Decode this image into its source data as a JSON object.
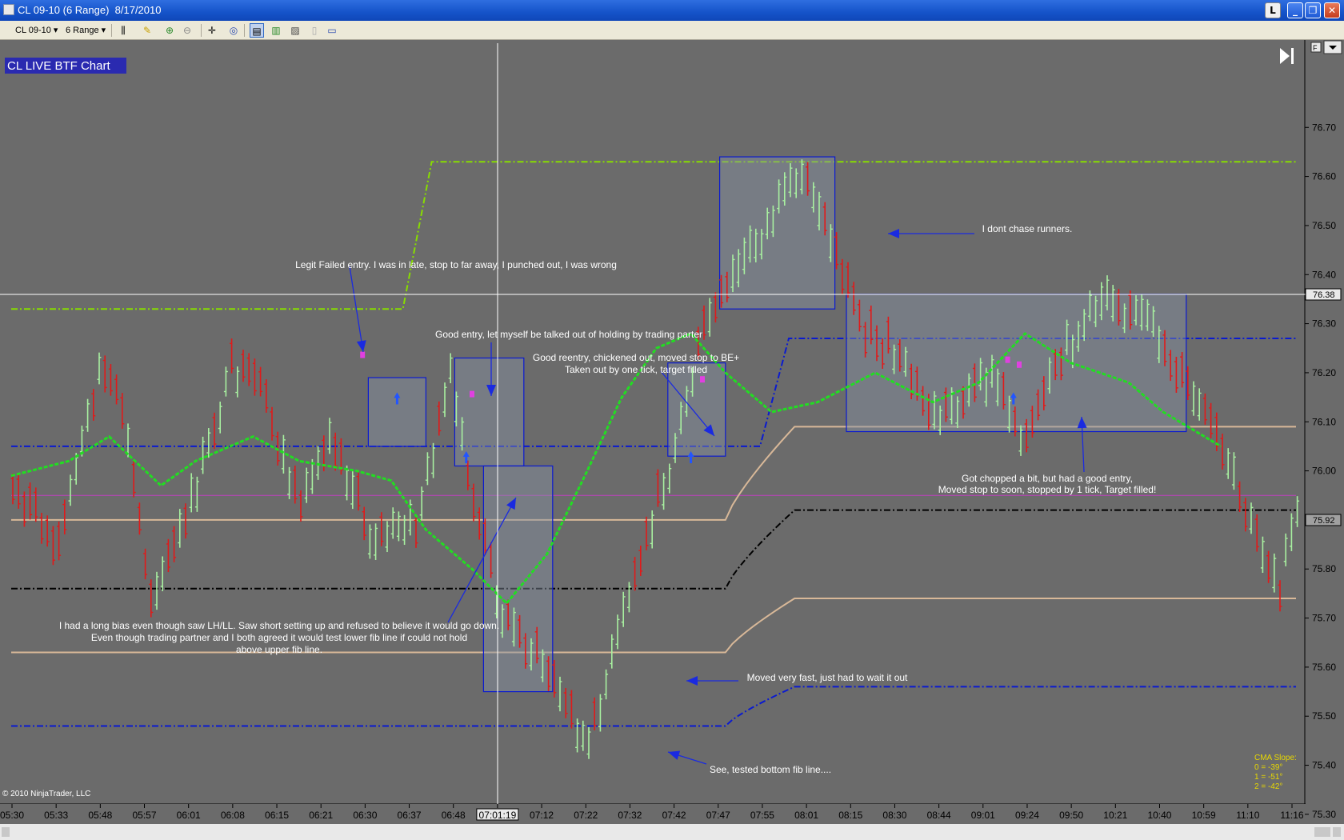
{
  "window": {
    "title": "CL 09-10 (6 Range)  8/17/2010",
    "buttons": [
      "L",
      "_",
      "❐",
      "✕"
    ]
  },
  "toolbar": {
    "instrument": "CL 09-10",
    "period": "6 Range"
  },
  "chart": {
    "label": "CL LIVE BTF Chart",
    "copyright": "© 2010 NinjaTrader, LLC",
    "crosshair_time": "07:01:19",
    "crosshair_price": "76.38",
    "last_price": "75.92",
    "cma_slope": {
      "title": "CMA Slope:",
      "lines": [
        "0 = -39°",
        "1 = -51°",
        "2 = -42°"
      ]
    },
    "colors": {
      "background": "#6b6b6b",
      "up_bar": "#a8f0a0",
      "down_bar": "#e01a1a",
      "cma": "#22dd22",
      "fib_green": "#88dd00",
      "fib_blue": "#0a1ad0",
      "fib_tan": "#d8b898",
      "fib_black": "#000000",
      "magenta": "#c040c0",
      "label_bg": "#2a2ab0"
    }
  },
  "chart_data": {
    "type": "bar",
    "subtype": "ohlc-range-bars",
    "instrument": "CL 09-10",
    "period": "6 Range",
    "date": "8/17/2010",
    "y_axis": {
      "ticks": [
        75.3,
        75.4,
        75.5,
        75.6,
        75.7,
        75.8,
        75.9,
        76.0,
        76.1,
        76.2,
        76.3,
        76.4,
        76.5,
        76.6,
        76.7
      ],
      "labels": [
        "75.30",
        "75.40",
        "75.50",
        "75.60",
        "75.70",
        "75.80",
        "75.90",
        "76.00",
        "76.10",
        "76.20",
        "76.30",
        "76.40",
        "76.50",
        "76.60",
        "76.70"
      ],
      "ylim": [
        75.27,
        76.78
      ]
    },
    "x_axis": {
      "labels": [
        "05:30",
        "05:33",
        "05:48",
        "05:57",
        "06:01",
        "06:08",
        "06:15",
        "06:21",
        "06:30",
        "06:37",
        "06:48",
        "07:01:19",
        "07:12",
        "07:22",
        "07:32",
        "07:42",
        "07:47",
        "07:55",
        "08:01",
        "08:15",
        "08:30",
        "08:44",
        "09:01",
        "09:24",
        "09:50",
        "10:21",
        "10:40",
        "10:59",
        "11:10",
        "11:16"
      ]
    },
    "price_path": [
      [
        0,
        75.98
      ],
      [
        8,
        75.86
      ],
      [
        15,
        76.22
      ],
      [
        19,
        76.14
      ],
      [
        24,
        75.76
      ],
      [
        30,
        75.9
      ],
      [
        38,
        76.22
      ],
      [
        43,
        76.18
      ],
      [
        50,
        75.92
      ],
      [
        55,
        76.1
      ],
      [
        62,
        75.88
      ],
      [
        70,
        75.9
      ],
      [
        76,
        76.2
      ],
      [
        79,
        76.0
      ],
      [
        85,
        75.72
      ],
      [
        92,
        75.62
      ],
      [
        100,
        75.45
      ],
      [
        108,
        75.8
      ],
      [
        114,
        76.02
      ],
      [
        120,
        76.3
      ],
      [
        126,
        76.42
      ],
      [
        133,
        76.55
      ],
      [
        138,
        76.62
      ],
      [
        142,
        76.48
      ],
      [
        148,
        76.3
      ],
      [
        153,
        76.25
      ],
      [
        160,
        76.12
      ],
      [
        170,
        76.2
      ],
      [
        176,
        76.08
      ],
      [
        183,
        76.26
      ],
      [
        190,
        76.38
      ],
      [
        198,
        76.3
      ],
      [
        208,
        76.1
      ],
      [
        215,
        75.9
      ],
      [
        220,
        75.78
      ],
      [
        223,
        75.92
      ]
    ],
    "moving_average": [
      [
        0,
        75.99
      ],
      [
        10,
        76.02
      ],
      [
        17,
        76.07
      ],
      [
        26,
        75.97
      ],
      [
        32,
        76.02
      ],
      [
        42,
        76.07
      ],
      [
        50,
        76.02
      ],
      [
        60,
        76.0
      ],
      [
        66,
        75.98
      ],
      [
        72,
        75.88
      ],
      [
        80,
        75.8
      ],
      [
        86,
        75.73
      ],
      [
        93,
        75.83
      ],
      [
        100,
        76.0
      ],
      [
        106,
        76.15
      ],
      [
        112,
        76.25
      ],
      [
        118,
        76.28
      ],
      [
        124,
        76.2
      ],
      [
        132,
        76.12
      ],
      [
        140,
        76.14
      ],
      [
        150,
        76.2
      ],
      [
        160,
        76.14
      ],
      [
        168,
        76.18
      ],
      [
        176,
        76.28
      ],
      [
        184,
        76.22
      ],
      [
        194,
        76.18
      ],
      [
        200,
        76.12
      ],
      [
        210,
        76.05
      ]
    ],
    "levels": [
      {
        "name": "upper fib green",
        "price": 76.33,
        "until": 68,
        "then": 76.63
      },
      {
        "name": "blue dashed",
        "price": 76.05,
        "until": 130,
        "then": 76.27
      },
      {
        "name": "magenta",
        "price": 75.95
      },
      {
        "name": "tan upper",
        "price": 75.9,
        "then": 76.09
      },
      {
        "name": "black dashed",
        "price": 75.76,
        "then": 75.92
      },
      {
        "name": "tan lower",
        "price": 75.63,
        "then": 75.74
      },
      {
        "name": "blue lower",
        "price": 75.48,
        "then": 75.56
      }
    ],
    "annotations": [
      "Legit Failed entry. I was in late, stop to far away, I punched out, I was wrong",
      "Good entry, let myself be talked out of holding by trading parter",
      "Good reentry, chickened out, moved stop to BE+",
      "Taken out by one tick, target filled",
      "I dont chase runners.",
      "I had a long bias even though saw LH/LL. Saw short setting up and refused to believe it would go down.",
      "Even though trading partner and I both agreed it would test lower fib line if could not hold",
      "above upper fib line.",
      "Moved very fast, just had to wait it out",
      "See, tested bottom fib line....",
      "Got chopped a bit, but had a good entry,",
      "Moved stop to soon, stopped by 1 tick, Target filled!"
    ]
  }
}
